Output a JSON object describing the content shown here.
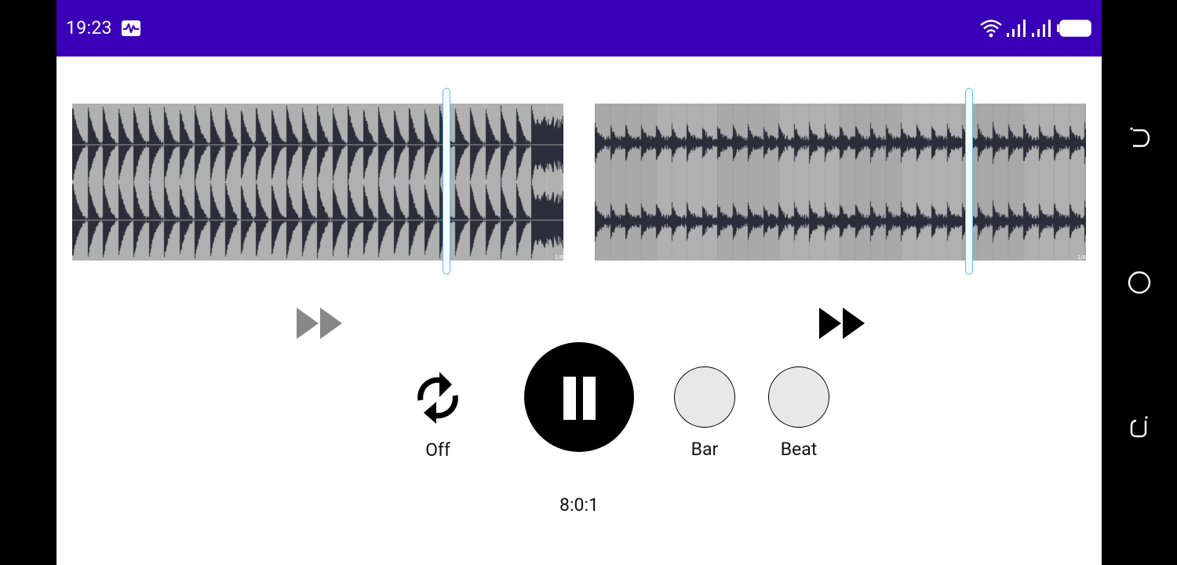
{
  "status_bar": {
    "time": "19:23",
    "icons": [
      "activity-monitor-icon",
      "wifi-icon",
      "cellular-signal-icon",
      "cellular-signal-icon",
      "battery-icon"
    ],
    "color": "#3a00b8"
  },
  "waveforms": {
    "left": {
      "page_label": "1/8",
      "playhead_fraction": 0.762
    },
    "right": {
      "page_label": "1/8",
      "playhead_fraction": 0.762
    }
  },
  "fast_forward": {
    "left": {
      "icon": "fast-forward-icon",
      "state": "disabled"
    },
    "right": {
      "icon": "fast-forward-icon",
      "state": "enabled"
    }
  },
  "controls": {
    "loop": {
      "icon": "repeat-icon",
      "label": "Off"
    },
    "play_pause": {
      "icon": "pause-icon"
    },
    "bar_indicator": {
      "label": "Bar"
    },
    "beat_indicator": {
      "label": "Beat"
    }
  },
  "position": "8:0:1",
  "nav_bar": {
    "buttons": [
      "back-icon",
      "home-icon",
      "recents-icon"
    ]
  },
  "colors": {
    "accent": "#3a00b8",
    "waveform_fill": "#2b2d3a",
    "waveform_background": "#b0b0b0",
    "playhead_border": "#5cc0e4",
    "indicator_fill": "#e8e8e8",
    "ff_disabled": "#888888",
    "ff_enabled": "#000000"
  }
}
